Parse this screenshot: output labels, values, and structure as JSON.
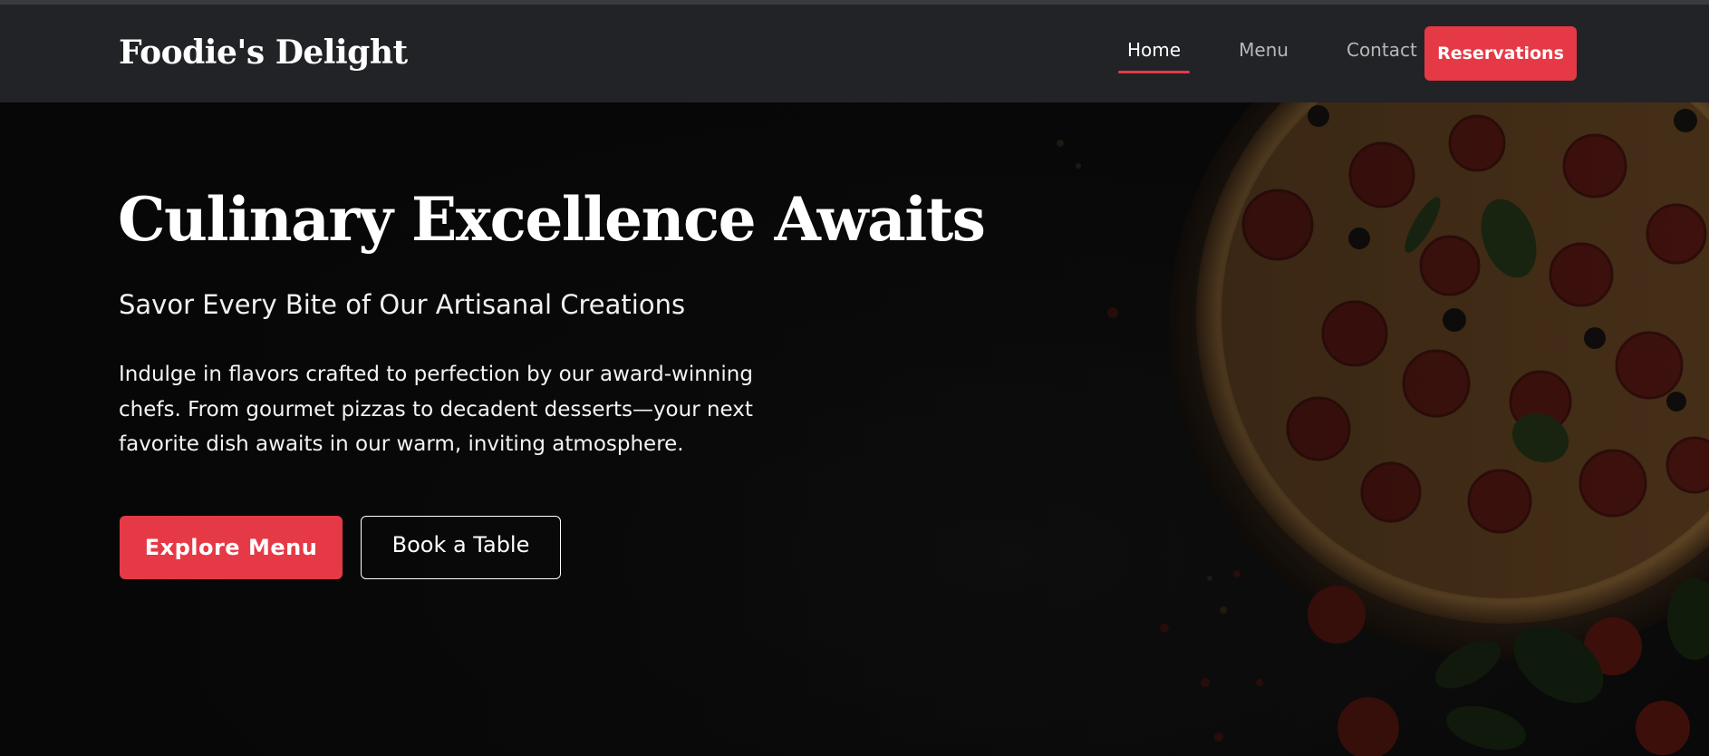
{
  "brand": {
    "name": "Foodie's Delight"
  },
  "nav": {
    "links": [
      {
        "label": "Home",
        "active": true
      },
      {
        "label": "Menu",
        "active": false
      },
      {
        "label": "Contact",
        "active": false
      }
    ],
    "cta_label": "Reservations"
  },
  "hero": {
    "title": "Culinary Excellence Awaits",
    "subtitle": "Savor Every Bite of Our Artisanal Creations",
    "description": "Indulge in flavors crafted to perfection by our award-winning chefs. From gourmet pizzas to decadent desserts—your next favorite dish awaits in our warm, inviting atmosphere.",
    "primary_button": "Explore Menu",
    "secondary_button": "Book a Table",
    "background_image": "pizza-photo"
  },
  "colors": {
    "accent": "#e63946",
    "navbar": "#212327",
    "hero_bg": "#0d0d0d",
    "text": "#ffffff"
  }
}
